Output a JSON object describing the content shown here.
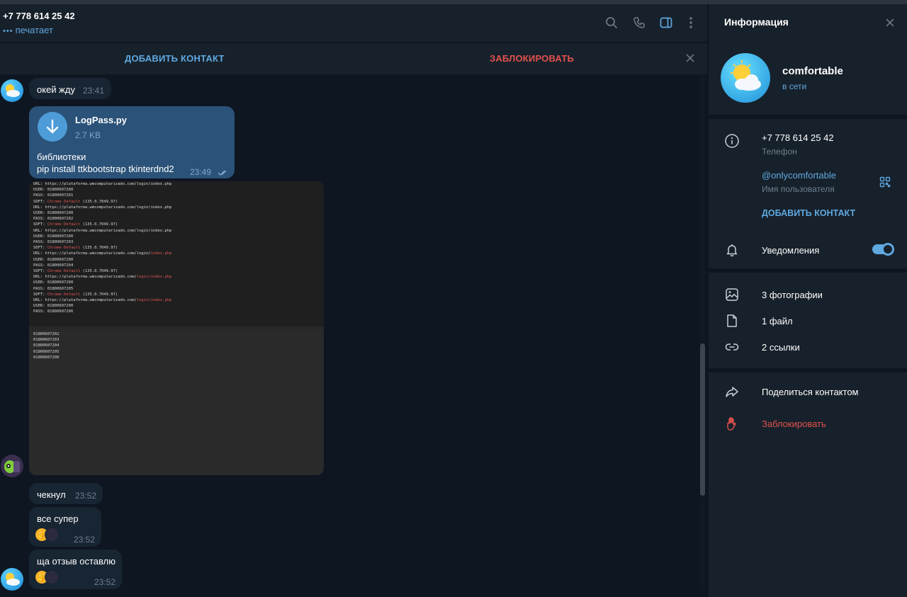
{
  "header": {
    "peer_name": "+7 778 614 25 42",
    "peer_status": "печатает",
    "icons": [
      "search-icon",
      "phone-icon",
      "sidebar-panel-icon",
      "more-vertical-icon"
    ]
  },
  "actionbar": {
    "add_contact": "ДОБАВИТЬ КОНТАКТ",
    "block": "ЗАБЛОКИРОВАТЬ"
  },
  "messages": {
    "m1": {
      "text": "окей жду",
      "time": "23:41"
    },
    "file": {
      "name": "LogPass.py",
      "size": "2.7 KB",
      "caption_line1": "библиотеки",
      "caption_line2": "pip install ttkbootstrap tkinterdnd2",
      "time": "23:49"
    },
    "m3": {
      "text": "чекнул",
      "time": "23:52"
    },
    "m4": {
      "text": "все супер",
      "time": "23:52"
    },
    "m5": {
      "text": "ща отзыв оставлю",
      "time": "23:52"
    }
  },
  "info": {
    "title": "Информация",
    "name": "comfortable",
    "status": "в сети",
    "phone": "+7 778 614 25 42",
    "phone_label": "Телефон",
    "username": "@onlycomfortable",
    "username_label": "Имя пользователя",
    "add_contact": "ДОБАВИТЬ КОНТАКТ",
    "notifications": "Уведомления",
    "notifications_on": true,
    "photos": "3 фотографии",
    "files": "1 файл",
    "links": "2 ссылки",
    "share": "Поделиться контактом",
    "block": "Заблокировать"
  },
  "colors": {
    "accent": "#5fa8e0",
    "danger": "#e2514d",
    "bg": "#0e1621",
    "panel": "#17212b",
    "bubble_in": "#182533",
    "bubble_out": "#2b5278"
  }
}
